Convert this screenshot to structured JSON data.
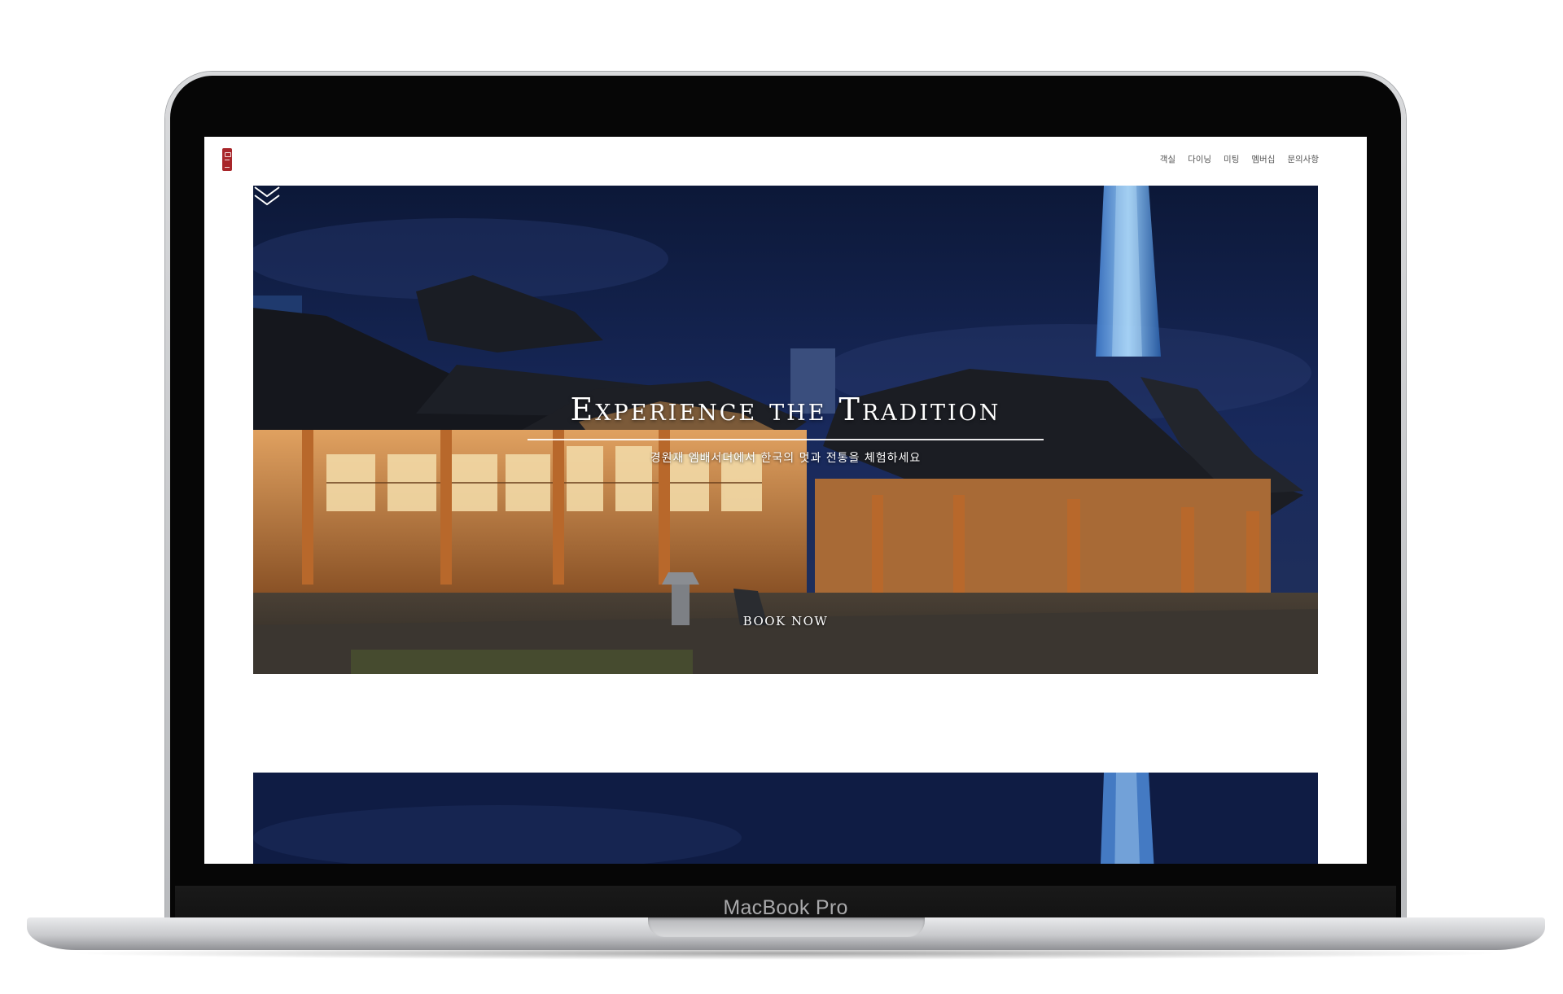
{
  "device": {
    "label": "MacBook Pro"
  },
  "site": {
    "nav": [
      "객실",
      "다이닝",
      "미팅",
      "멤버십",
      "문의사항"
    ]
  },
  "hero": {
    "title": "Experience the Tradition",
    "subtitle": "경원재 엠배서더에서 한국의 멋과 전통을 체험하세요",
    "cta": "BOOK NOW"
  },
  "colors": {
    "logo": "#a8262a",
    "sky": "#16275a",
    "nav_text": "#555555"
  },
  "icons": {
    "logo": "seal-logo-icon",
    "scroll": "double-chevron-down-icon"
  }
}
